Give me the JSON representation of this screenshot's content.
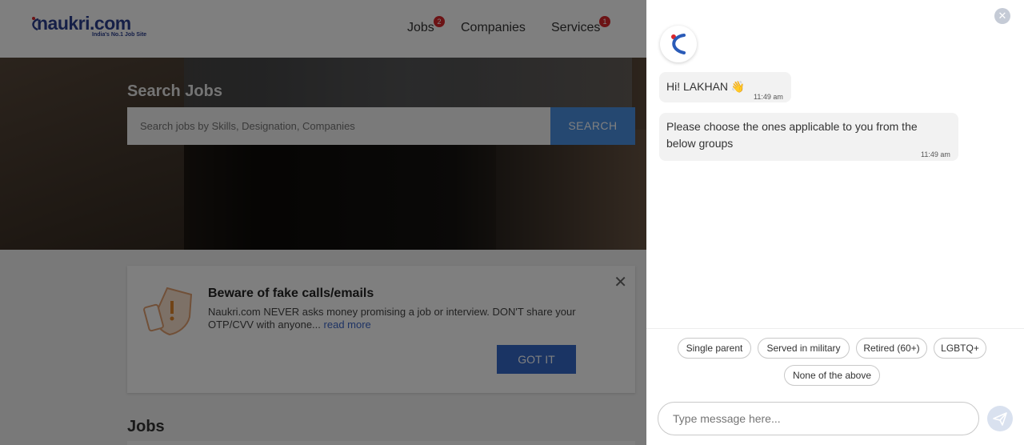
{
  "header": {
    "logo_text": "naukri.com",
    "logo_tagline": "India's No.1 Job Site",
    "nav": [
      {
        "label": "Jobs",
        "badge": "2"
      },
      {
        "label": "Companies",
        "badge": ""
      },
      {
        "label": "Services",
        "badge": "1"
      }
    ]
  },
  "hero": {
    "title": "Search Jobs",
    "search_placeholder": "Search jobs by Skills, Designation, Companies",
    "search_button": "SEARCH"
  },
  "warning": {
    "title": "Beware of fake calls/emails",
    "text": "Naukri.com NEVER asks money promising a job or interview. DON'T share your OTP/CVV with anyone...",
    "link": "read more",
    "button": "GOT IT"
  },
  "jobs_heading": "Jobs",
  "chat": {
    "messages": [
      {
        "text": "Hi! LAKHAN 👋",
        "time": "11:49 am"
      },
      {
        "text": "Please choose the ones applicable to you from the below groups",
        "time": "11:49 am"
      }
    ],
    "chips": [
      "Single parent",
      "Served in military",
      "Retired (60+)",
      "LGBTQ+",
      "None of the above"
    ],
    "input_placeholder": "Type message here...",
    "colors": {
      "chip_border": "#c8c8c8",
      "bubble_bg": "#f2f2f2",
      "send_bg": "#d9e1ef"
    }
  }
}
